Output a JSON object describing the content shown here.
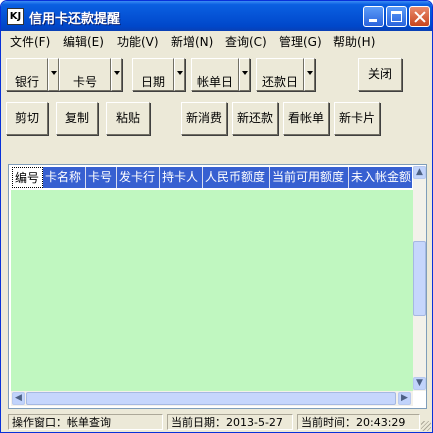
{
  "window": {
    "title": "信用卡还款提醒",
    "icon_text": "KJ"
  },
  "menu": [
    "文件(F)",
    "编辑(E)",
    "功能(V)",
    "新增(N)",
    "查询(C)",
    "管理(G)",
    "帮助(H)"
  ],
  "toolbar": {
    "bank": "银行",
    "card_no": "卡号",
    "date": "日期",
    "bill_day": "帐单日",
    "repay_day": "还款日",
    "close": "关闭",
    "cut": "剪切",
    "copy": "复制",
    "paste": "粘贴",
    "new_spend": "新消费",
    "new_repay": "新还款",
    "view_bill": "看帐单",
    "new_card": "新卡片"
  },
  "grid": {
    "columns": [
      "编号",
      "卡名称",
      "卡号",
      "发卡行",
      "持卡人",
      "人民币额度",
      "当前可用额度",
      "未入帐金额"
    ],
    "rows": [],
    "body_color": "#c0f7c0",
    "header_color": "#3760d1"
  },
  "status": {
    "window": "操作窗口：帐单查询",
    "date": "当前日期：2013-5-27",
    "time": "当前时间：20:43:29"
  }
}
